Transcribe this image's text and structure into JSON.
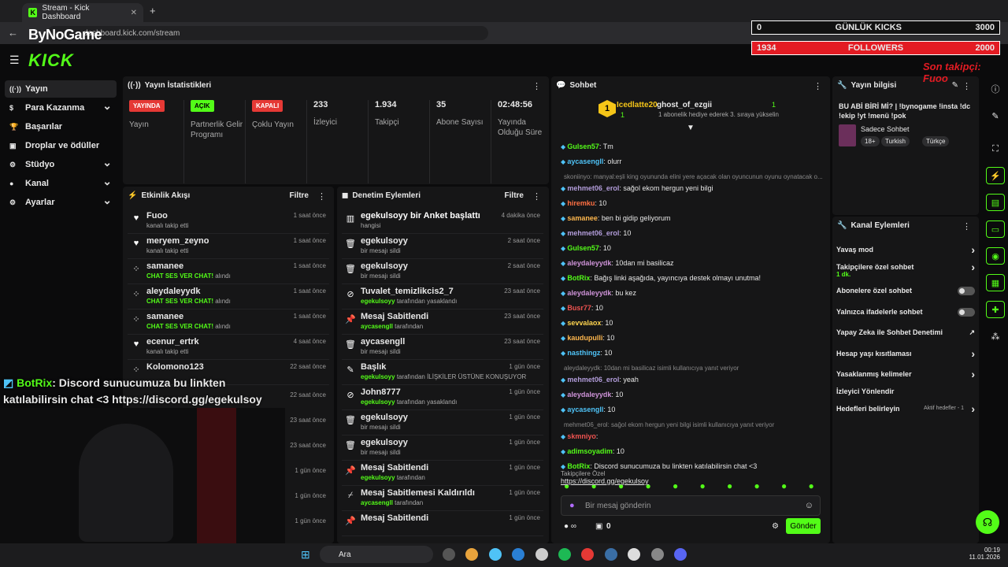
{
  "browser": {
    "tab_title": "Stream - Kick Dashboard",
    "url": "dashboard.kick.com/stream",
    "overlay_brand": "ByNoGame"
  },
  "logo": "KICK",
  "sidebar": [
    {
      "label": "Yayın",
      "icon": "stream-icon",
      "expand": false
    },
    {
      "label": "Para Kazanma",
      "icon": "dollar-icon",
      "expand": true
    },
    {
      "label": "Başarılar",
      "icon": "trophy-icon",
      "expand": false
    },
    {
      "label": "Droplar ve ödüller",
      "icon": "gift-icon",
      "expand": false
    },
    {
      "label": "Stüdyo",
      "icon": "gear-icon",
      "expand": true
    },
    {
      "label": "Kanal",
      "icon": "user-icon",
      "expand": true
    },
    {
      "label": "Ayarlar",
      "icon": "gear-icon",
      "expand": true
    }
  ],
  "stats": {
    "title": "Yayın İstatistikleri",
    "items": [
      {
        "badge": "YAYINDA",
        "badge_color": "#e53935",
        "label": "Yayın"
      },
      {
        "badge": "AÇIK",
        "badge_color": "#53fc18",
        "label": "Partnerlik Gelir Programı"
      },
      {
        "badge": "KAPALI",
        "badge_color": "#e53935",
        "label": "Çoklu Yayın"
      },
      {
        "value": "233",
        "label": "İzleyici"
      },
      {
        "value": "1.934",
        "label": "Takipçi"
      },
      {
        "value": "35",
        "label": "Abone Sayısı"
      },
      {
        "value": "02:48:56",
        "label": "Yayında Olduğu Süre"
      }
    ]
  },
  "activity": {
    "title": "Etkinlik Akışı",
    "filter": "Filtre",
    "rows": [
      {
        "name": "Fuoo",
        "sub": "kanalı takip etti",
        "time": "1 saat önce",
        "icon": "heart-icon"
      },
      {
        "name": "meryem_zeyno",
        "sub": "kanalı takip etti",
        "time": "1 saat önce",
        "icon": "heart-icon"
      },
      {
        "name": "samanee",
        "hl": "CHAT SES VER CHAT!",
        "sub": "alındı",
        "time": "1 saat önce",
        "icon": "points-icon"
      },
      {
        "name": "aleydaleyydk",
        "hl": "CHAT SES VER CHAT!",
        "sub": "alındı",
        "time": "1 saat önce",
        "icon": "points-icon"
      },
      {
        "name": "samanee",
        "hl": "CHAT SES VER CHAT!",
        "sub": "alındı",
        "time": "1 saat önce",
        "icon": "points-icon"
      },
      {
        "name": "ecenur_ertrk",
        "sub": "kanalı takip etti",
        "time": "4 saat önce",
        "icon": "heart-icon"
      },
      {
        "name": "Kolomono123",
        "sub": "",
        "time": "22 saat önce",
        "icon": "points-icon"
      }
    ],
    "extra_times": [
      "22 saat önce",
      "23 saat önce",
      "23 saat önce",
      "1 gün önce",
      "1 gün önce",
      "1 gün önce"
    ]
  },
  "moderation": {
    "title": "Denetim Eylemleri",
    "filter": "Filtre",
    "rows": [
      {
        "name": "egekulsoyy bir Anket başlattı",
        "sub": "hangisi",
        "time": "4 dakika önce",
        "icon": "poll-icon",
        "green": "egekulsoyy"
      },
      {
        "name": "egekulsoyy",
        "sub": "bir mesajı sildi",
        "time": "2 saat önce",
        "icon": "trash-icon"
      },
      {
        "name": "egekulsoyy",
        "sub": "bir mesajı sildi",
        "time": "2 saat önce",
        "icon": "trash-icon"
      },
      {
        "name": "Tuvalet_temizlikcis2_7",
        "sub_g": "egekulsoyy",
        "sub": "tarafından yasaklandı",
        "time": "23 saat önce",
        "icon": "ban-icon"
      },
      {
        "name": "Mesaj Sabitlendi",
        "sub_g": "aycasengll",
        "sub": "tarafından",
        "time": "23 saat önce",
        "icon": "pin-icon"
      },
      {
        "name": "aycasengll",
        "sub": "bir mesajı sildi",
        "time": "23 saat önce",
        "icon": "trash-icon"
      },
      {
        "name": "Başlık",
        "sub_g": "egekulsoyy",
        "sub": "tarafından İLİŞKİLER ÜSTÜNE KONUŞUYORUZ... | !bynogame !insta !dc !ekip !yt !menü !pok olarak değiştirildi",
        "time": "1 gün önce",
        "icon": "user-edit-icon"
      },
      {
        "name": "John8777",
        "sub_g": "egekulsoyy",
        "sub": "tarafından yasaklandı",
        "time": "1 gün önce",
        "icon": "ban-icon"
      },
      {
        "name": "egekulsoyy",
        "sub": "bir mesajı sildi",
        "time": "1 gün önce",
        "icon": "trash-icon"
      },
      {
        "name": "egekulsoyy",
        "sub": "bir mesajı sildi",
        "time": "1 gün önce",
        "icon": "trash-icon"
      },
      {
        "name": "Mesaj Sabitlendi",
        "sub_g": "egekulsoyy",
        "sub": "tarafından",
        "time": "1 gün önce",
        "icon": "pin-icon"
      },
      {
        "name": "Mesaj Sabitlemesi Kaldırıldı",
        "sub_g": "aycasengll",
        "sub": "tarafından",
        "time": "1 gün önce",
        "icon": "unpin-icon"
      },
      {
        "name": "Mesaj Sabitlendi",
        "sub": "",
        "time": "1 gün önce",
        "icon": "pin-icon"
      }
    ]
  },
  "chat": {
    "title": "Sohbet",
    "gift_user1": "Icedlatte20",
    "gift_count1": "1",
    "gift_user2": "ghost_of_ezgii",
    "gift_count2": "1",
    "gift_note": "1 abonelik hediye ederek 3. sıraya yükselin",
    "lines": [
      {
        "u": "Gulsen57",
        "c": "#53fc18",
        "t": ": Tm"
      },
      {
        "u": "aycasengll",
        "c": "#4fc3f7",
        "t": ": olurr"
      },
      {
        "reply": "skoniinyo: manyal:eşli king oyununda elini yere açacak olan oyuncunun oyunu oynatacak o..."
      },
      {
        "u": "mehmet06_erol",
        "c": "#b39ddb",
        "t": ": sağol ekom hergun yeni bilgi"
      },
      {
        "u": "hiremku",
        "c": "#ff7043",
        "t": ": 10"
      },
      {
        "u": "samanee",
        "c": "#ffb74d",
        "t": ": ben bi gidip geliyorum"
      },
      {
        "u": "mehmet06_erol",
        "c": "#b39ddb",
        "t": ": 10"
      },
      {
        "u": "Gulsen57",
        "c": "#53fc18",
        "t": ": 10"
      },
      {
        "u": "aleydaleyydk",
        "c": "#ce93d8",
        "t": ": 10dan mi basilicaz"
      },
      {
        "u": "BotRix",
        "c": "#53fc18",
        "t": ": Bağış linki aşağıda, yayıncıya destek olmayı unutma!"
      },
      {
        "u": "aleydaleyydk",
        "c": "#ce93d8",
        "t": ": bu kez"
      },
      {
        "u": "Busr77",
        "c": "#ef5350",
        "t": ": 10"
      },
      {
        "u": "sevvalaox",
        "c": "#ffd54f",
        "t": ": 10"
      },
      {
        "u": "kaudupulli",
        "c": "#ffb74d",
        "t": ": 10"
      },
      {
        "u": "nasthingz",
        "c": "#4fc3f7",
        "t": ": 10"
      },
      {
        "reply": "aleydaleyydk: 10dan mi basilicaz isimli kullanıcıya yanıt veriyor"
      },
      {
        "u": "mehmet06_erol",
        "c": "#b39ddb",
        "t": ": yeah"
      },
      {
        "u": "aleydaleyydk",
        "c": "#ce93d8",
        "t": ": 10"
      },
      {
        "u": "aycasengll",
        "c": "#4fc3f7",
        "t": ": 10"
      },
      {
        "reply": "mehmet06_erol: sağol ekom hergun yeni bilgi isimli kullanıcıya yanıt veriyor"
      },
      {
        "u": "skmniyo",
        "c": "#ef5350",
        "t": ":"
      },
      {
        "u": "adimsoyadim",
        "c": "#53fc18",
        "t": ": 10"
      },
      {
        "u": "BotRix",
        "c": "#53fc18",
        "t": ": Discord sunucumuza bu linkten katılabilirsin chat <3"
      },
      {
        "link": "https://discord.gg/egekulsoy"
      }
    ],
    "emote_label": "Takipçilere Özel",
    "input_placeholder": "Bir mesaj gönderin",
    "points": "0",
    "send": "Gönder"
  },
  "stream_info": {
    "title": "Yayın bilgisi",
    "stream_title": "BU ABİ BİRİ Mİ? | !bynogame !insta !dc !ekip !yt !menü !pok",
    "category": "Sadece Sohbet",
    "tags": [
      "18+",
      "Turkish",
      "Türkçe"
    ]
  },
  "channel_actions": {
    "title": "Kanal Eylemleri",
    "items": [
      {
        "label": "Yavaş mod",
        "type": "chev"
      },
      {
        "label": "Takipçilere özel sohbet",
        "sub": "1 dk.",
        "type": "chev"
      },
      {
        "label": "Abonelere özel sohbet",
        "type": "toggle"
      },
      {
        "label": "Yalnızca ifadelerle sohbet",
        "type": "toggle"
      },
      {
        "label": "Yapay Zeka ile Sohbet Denetimi",
        "type": "ext"
      },
      {
        "label": "Hesap yaşı kısıtlaması",
        "type": "chev"
      },
      {
        "label": "Yasaklanmış kelimeler",
        "type": "chev"
      },
      {
        "label": "İzleyici Yönlendir",
        "type": "none"
      },
      {
        "label": "Hedefleri belirleyin",
        "extra": "Aktif hedefler - 1",
        "type": "chev"
      }
    ]
  },
  "overlay": {
    "daily_left": "0",
    "daily_label": "GÜNLÜK KICKS",
    "daily_right": "3000",
    "fol_left": "1934",
    "fol_label": "FOLLOWERS",
    "fol_right": "2000",
    "last_follower": "Son takipçi: Fuoo",
    "bot_name": "BotRix",
    "bot_msg": ": Discord sunucumuza bu linkten katılabilirsin chat <3 https://discord.gg/egekulsoy"
  },
  "taskbar": {
    "search": "Ara",
    "time": "00:19",
    "date": "11.01.2026"
  },
  "colors": {
    "accent": "#53fc18",
    "live": "#e53935",
    "panel": "#161617"
  }
}
